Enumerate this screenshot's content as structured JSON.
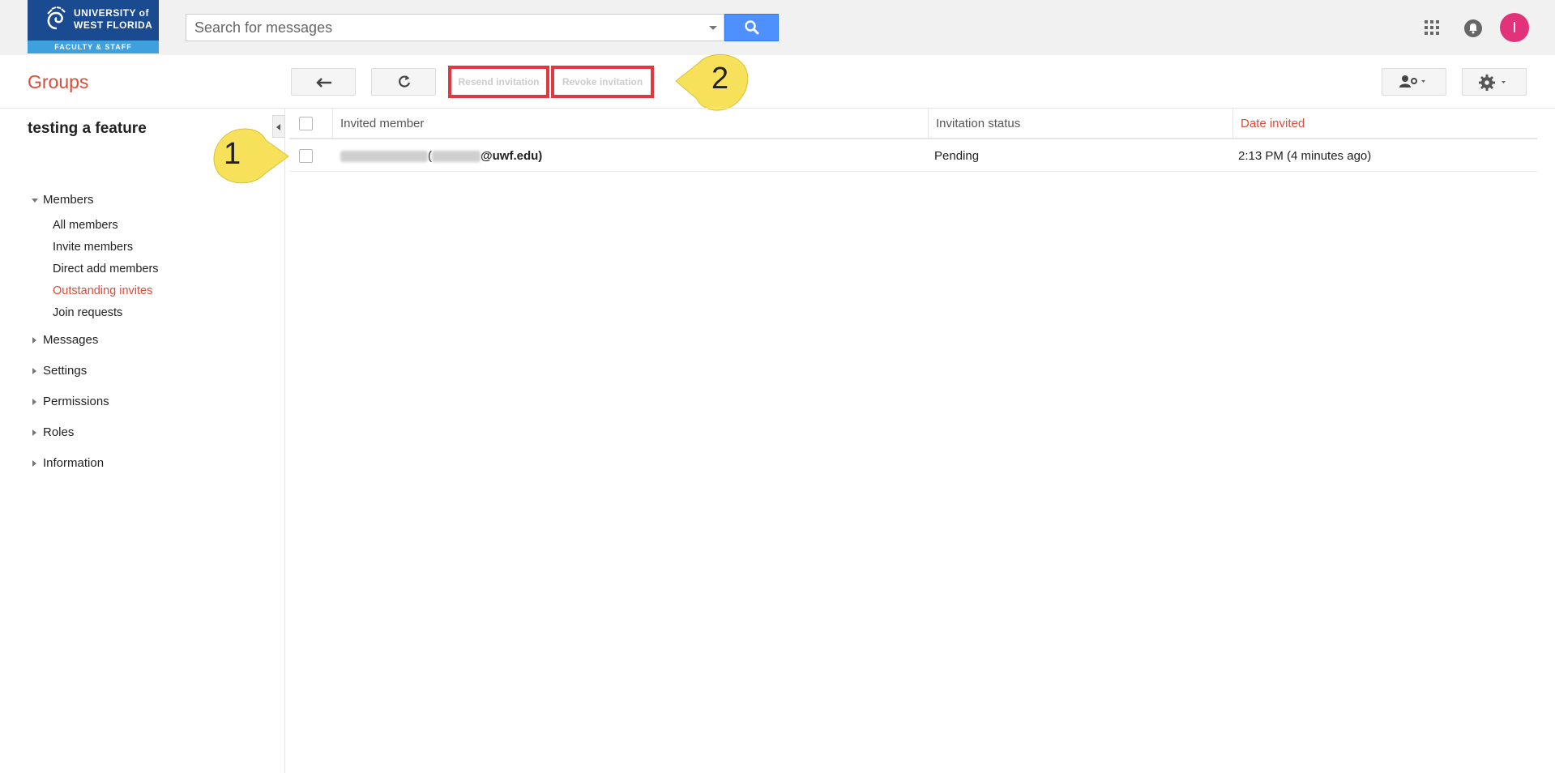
{
  "header": {
    "logo": {
      "line1": "UNIVERSITY of",
      "line2": "WEST FLORIDA",
      "subtitle": "FACULTY & STAFF"
    },
    "search": {
      "placeholder": "Search for messages",
      "value": ""
    },
    "avatar_letter": "I"
  },
  "toolbar": {
    "title": "Groups",
    "resend_label": "Resend invitation",
    "revoke_label": "Revoke invitation",
    "callout_1": "1",
    "callout_2": "2"
  },
  "sidebar": {
    "group_name": "testing a feature",
    "sections": [
      {
        "label": "Members",
        "expanded": true
      },
      {
        "label": "Messages",
        "expanded": false
      },
      {
        "label": "Settings",
        "expanded": false
      },
      {
        "label": "Permissions",
        "expanded": false
      },
      {
        "label": "Roles",
        "expanded": false
      },
      {
        "label": "Information",
        "expanded": false
      }
    ],
    "members_items": [
      {
        "label": "All members"
      },
      {
        "label": "Invite members"
      },
      {
        "label": "Direct add members"
      },
      {
        "label": "Outstanding invites",
        "active": true
      },
      {
        "label": "Join requests"
      }
    ]
  },
  "table": {
    "columns": [
      "Invited member",
      "Invitation status",
      "Date invited"
    ],
    "rows": [
      {
        "member_open": "(",
        "member_email_domain": "@uwf.edu)",
        "status": "Pending",
        "date": "2:13 PM (4 minutes ago)"
      }
    ]
  },
  "colors": {
    "accent": "#dd4b39",
    "search_button": "#4d90fe",
    "highlight_box": "#e0383e",
    "callout": "#f7e05a",
    "avatar": "#e2327a"
  }
}
